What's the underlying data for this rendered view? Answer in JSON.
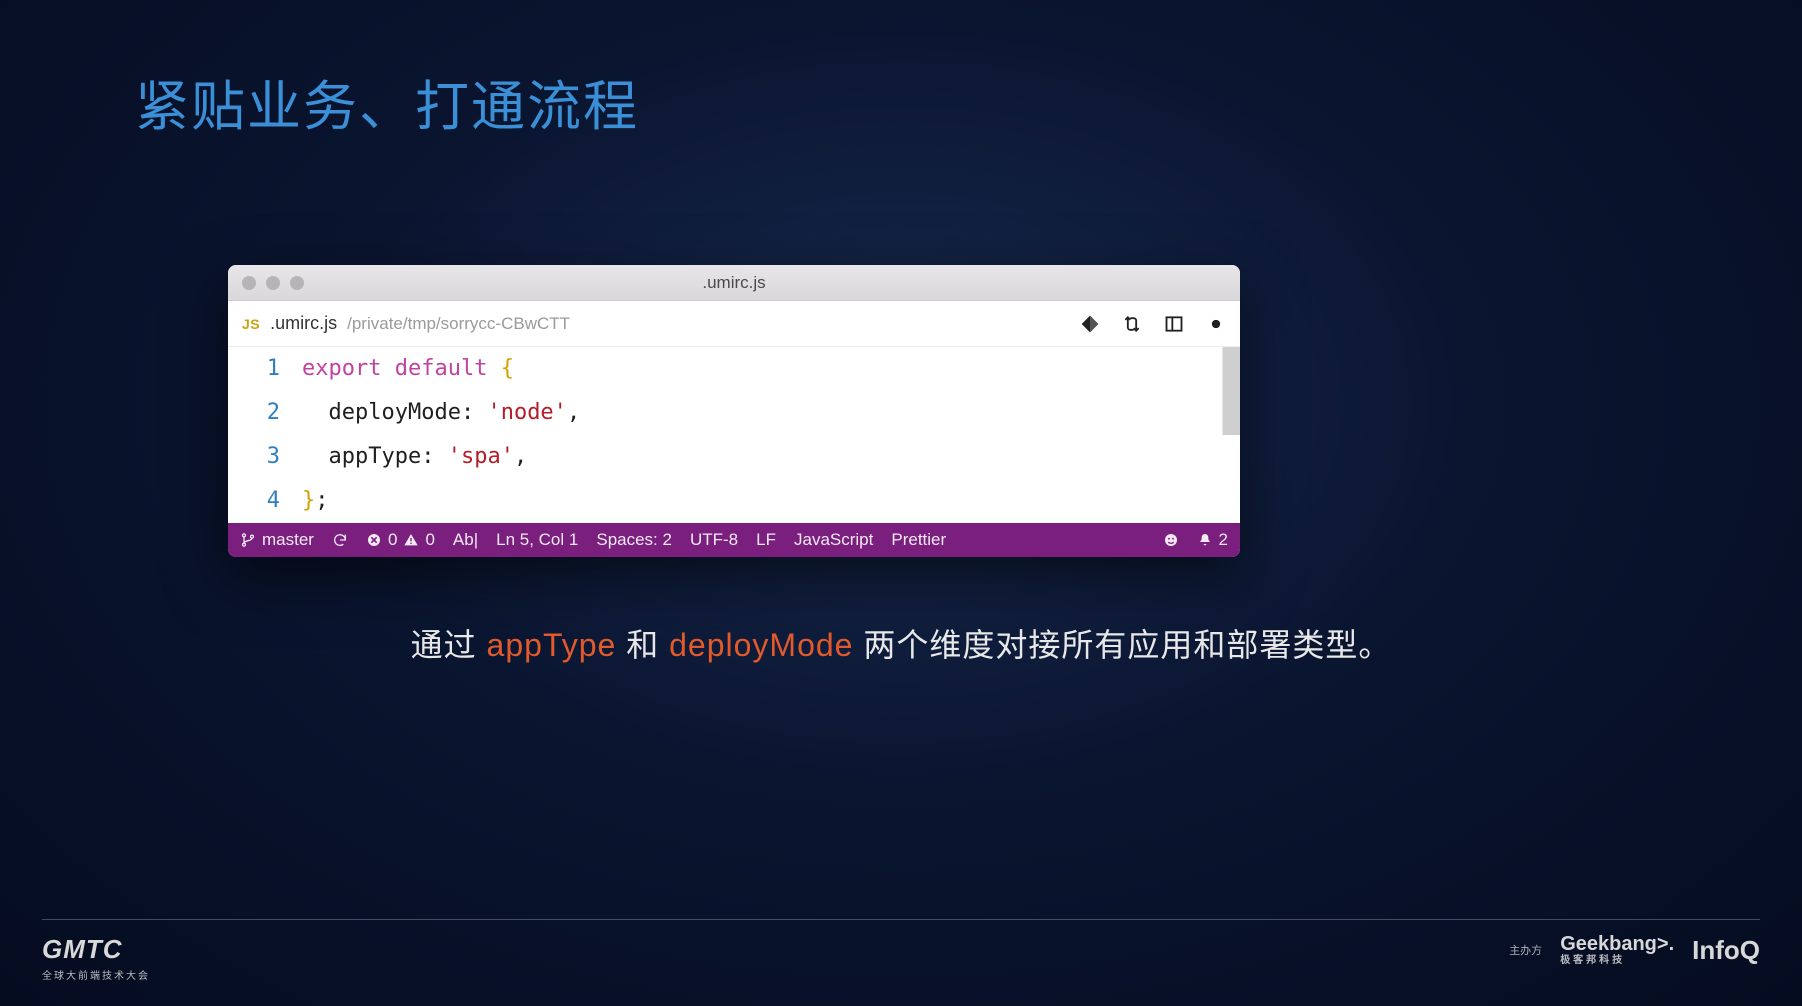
{
  "slide": {
    "title": "紧贴业务、打通流程"
  },
  "window": {
    "title": ".umirc.js"
  },
  "tab": {
    "badge": "JS",
    "filename": ".umirc.js",
    "path": "/private/tmp/sorrycc-CBwCTT"
  },
  "code": {
    "line_numbers": [
      "1",
      "2",
      "3",
      "4"
    ],
    "l1": {
      "kw_export": "export",
      "kw_default": "default",
      "brace_open": "{"
    },
    "l2": {
      "prop": "deployMode",
      "colon": ":",
      "str": "'node'",
      "comma": ","
    },
    "l3": {
      "prop": "appType",
      "colon": ":",
      "str": "'spa'",
      "comma": ","
    },
    "l4": {
      "brace_close": "}",
      "semi": ";"
    }
  },
  "status": {
    "branch": "master",
    "errors": "0",
    "warnings": "0",
    "ab": "Ab|",
    "position": "Ln 5, Col 1",
    "spaces": "Spaces: 2",
    "encoding": "UTF-8",
    "eol": "LF",
    "language": "JavaScript",
    "formatter": "Prettier",
    "bell_count": "2"
  },
  "caption": {
    "pre": "通过 ",
    "hl1": "appType",
    "mid": " 和 ",
    "hl2": "deployMode",
    "post": " 两个维度对接所有应用和部署类型。"
  },
  "footer": {
    "gmtc": "GMTC",
    "gmtc_sub": "全球大前端技术大会",
    "sponsor_label": "主办方",
    "geekbang": "Geekbang>.",
    "geekbang_sub": "极客邦科技",
    "infoq": "InfoQ"
  }
}
